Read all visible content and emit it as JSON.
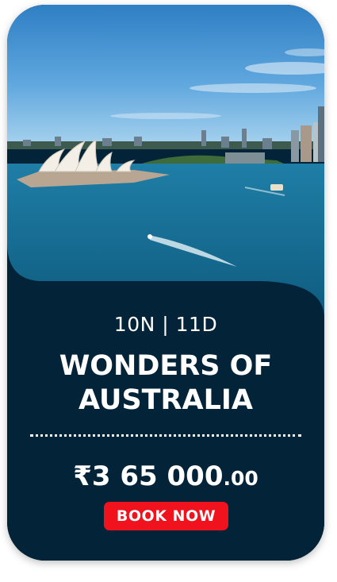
{
  "package": {
    "duration": "10N | 11D",
    "title_lines": [
      "WONDERS OF",
      "AUSTRALIA"
    ],
    "price": {
      "currency_symbol": "₹",
      "amount": "3 65 000",
      "decimal": ".00"
    },
    "book_button_label": "BOOK NOW"
  },
  "colors": {
    "panel_background": "#032338",
    "button_background": "#f0121c",
    "text": "#ffffff"
  },
  "image": {
    "subject": "sydney-harbour-opera-house-photo"
  }
}
